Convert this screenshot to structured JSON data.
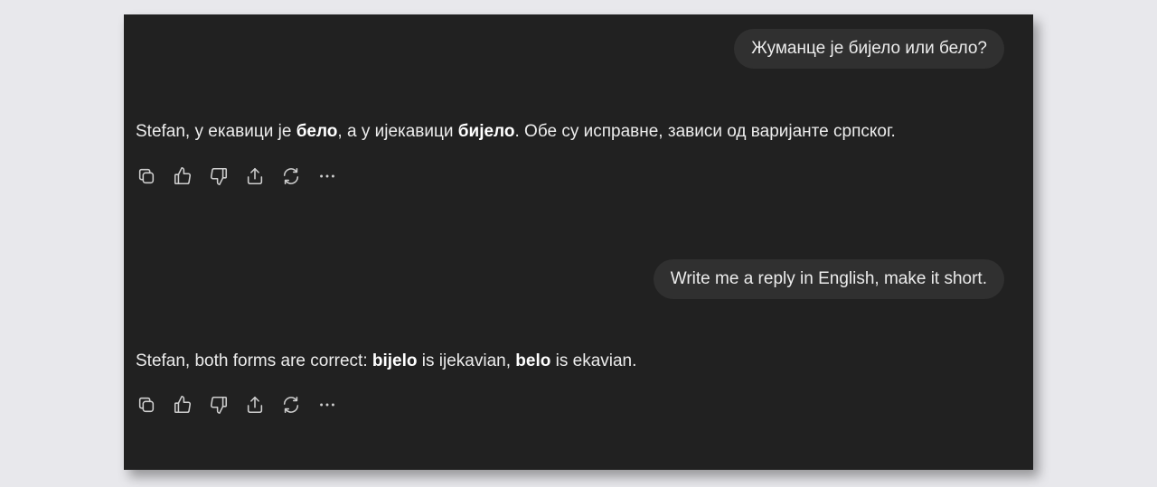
{
  "conversation": {
    "messages": [
      {
        "role": "user",
        "text": "Жуманце је бијело или бело?"
      },
      {
        "role": "assistant",
        "parts": [
          {
            "text": "Stefan, у екавици је ",
            "bold": false
          },
          {
            "text": "бело",
            "bold": true
          },
          {
            "text": ", а у ијекавици ",
            "bold": false
          },
          {
            "text": "бијело",
            "bold": true
          },
          {
            "text": ". Обе су исправне, зависи од варијанте српског.",
            "bold": false
          }
        ],
        "actions": [
          "copy-icon",
          "thumbs-up-icon",
          "thumbs-down-icon",
          "share-icon",
          "regenerate-icon",
          "more-icon"
        ]
      },
      {
        "role": "user",
        "text": "Write me a reply in English, make it short."
      },
      {
        "role": "assistant",
        "parts": [
          {
            "text": "Stefan, both forms are correct: ",
            "bold": false
          },
          {
            "text": "bijelo",
            "bold": true
          },
          {
            "text": " is ijekavian, ",
            "bold": false
          },
          {
            "text": "belo",
            "bold": true
          },
          {
            "text": " is ekavian.",
            "bold": false
          }
        ],
        "actions": [
          "copy-icon",
          "thumbs-up-icon",
          "thumbs-down-icon",
          "share-icon",
          "regenerate-icon",
          "more-icon"
        ]
      }
    ]
  },
  "colors": {
    "page_background": "#e8e8ec",
    "chat_background": "#212121",
    "user_bubble": "#303030",
    "text": "#ececec"
  }
}
